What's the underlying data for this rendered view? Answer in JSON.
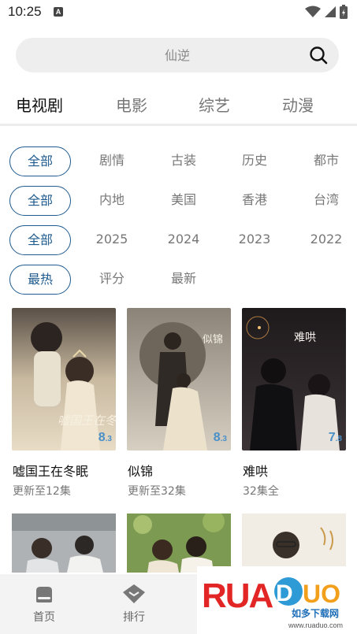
{
  "status_bar": {
    "time": "10:25",
    "notification_icon": "A"
  },
  "search": {
    "placeholder": "仙逆"
  },
  "main_tabs": [
    {
      "label": "电视剧",
      "active": true
    },
    {
      "label": "电影",
      "active": false
    },
    {
      "label": "综艺",
      "active": false
    },
    {
      "label": "动漫",
      "active": false
    }
  ],
  "filters": {
    "genre": [
      "全部",
      "剧情",
      "古装",
      "历史",
      "都市"
    ],
    "region": [
      "全部",
      "内地",
      "美国",
      "香港",
      "台湾"
    ],
    "year": [
      "全部",
      "2025",
      "2024",
      "2023",
      "2022"
    ],
    "sort": [
      "最热",
      "评分",
      "最新"
    ]
  },
  "shows": [
    {
      "title": "嘘国王在冬眠",
      "subtitle": "更新至12集",
      "rating_int": "8",
      "rating_dec": ".3",
      "poster_text": "嘘国王在冬眠"
    },
    {
      "title": "似锦",
      "subtitle": "更新至32集",
      "rating_int": "8",
      "rating_dec": ".3",
      "poster_text": "似锦"
    },
    {
      "title": "难哄",
      "subtitle": "32集全",
      "rating_int": "7",
      "rating_dec": ".8",
      "poster_text": "难哄"
    }
  ],
  "bottom_nav": {
    "home_label": "首页",
    "rank_label": "排行"
  },
  "watermark": {
    "brand": "RUANDUO",
    "cn": "如多下载网",
    "url": "www.ruaduo.com"
  },
  "colors": {
    "accent": "#1f5b8e",
    "rating": "#4a90c8",
    "nav_bg": "#f3f3f3",
    "search_bg": "#eeeeee"
  }
}
